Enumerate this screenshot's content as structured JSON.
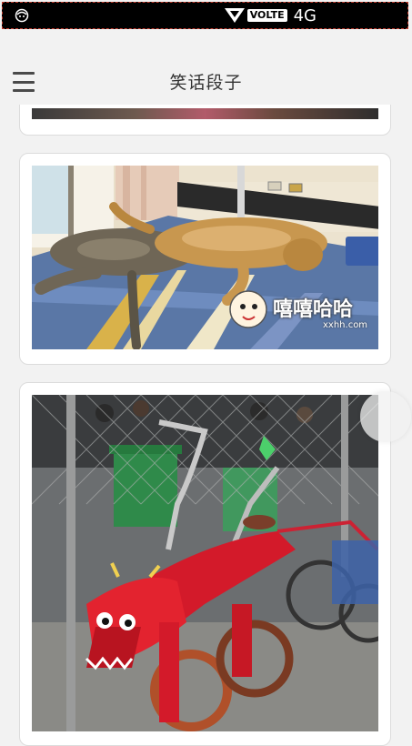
{
  "status_bar": {
    "left_icon": "notification-face-icon",
    "signal_icon": "signal-icon",
    "volte": "VOLTE",
    "network": "4G"
  },
  "app_bar": {
    "menu_icon": "hamburger-menu-icon",
    "title": "笑话段子"
  },
  "feed": {
    "items": [
      {
        "kind": "image"
      },
      {
        "kind": "image",
        "watermark_name": "嘻嘻哈哈",
        "watermark_url": "xxhh.com"
      },
      {
        "kind": "image"
      }
    ]
  }
}
